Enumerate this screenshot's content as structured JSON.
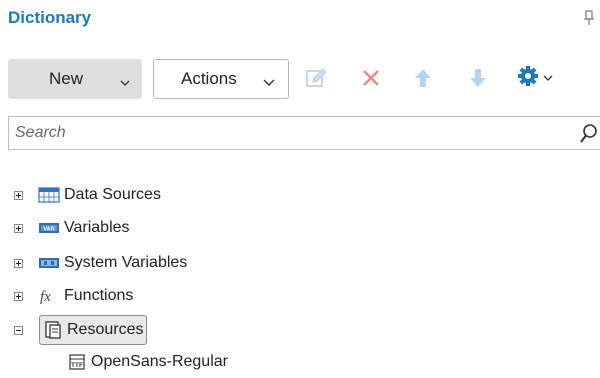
{
  "panel": {
    "title": "Dictionary"
  },
  "toolbar": {
    "new_label": "New",
    "actions_label": "Actions"
  },
  "search": {
    "placeholder": "Search",
    "value": ""
  },
  "tree": {
    "items": [
      {
        "label": "Data Sources",
        "expanded": false,
        "icon": "data-sources-icon"
      },
      {
        "label": "Variables",
        "expanded": false,
        "icon": "variables-icon"
      },
      {
        "label": "System Variables",
        "expanded": false,
        "icon": "system-variables-icon"
      },
      {
        "label": "Functions",
        "expanded": false,
        "icon": "functions-icon"
      },
      {
        "label": "Resources",
        "expanded": true,
        "selected": true,
        "icon": "resources-icon",
        "children": [
          {
            "label": "OpenSans-Regular",
            "icon": "font-resource-icon"
          }
        ]
      }
    ]
  },
  "colors": {
    "title": "#1b79c2",
    "accent_blue": "#1b79c2",
    "delete_red": "#e06060"
  }
}
